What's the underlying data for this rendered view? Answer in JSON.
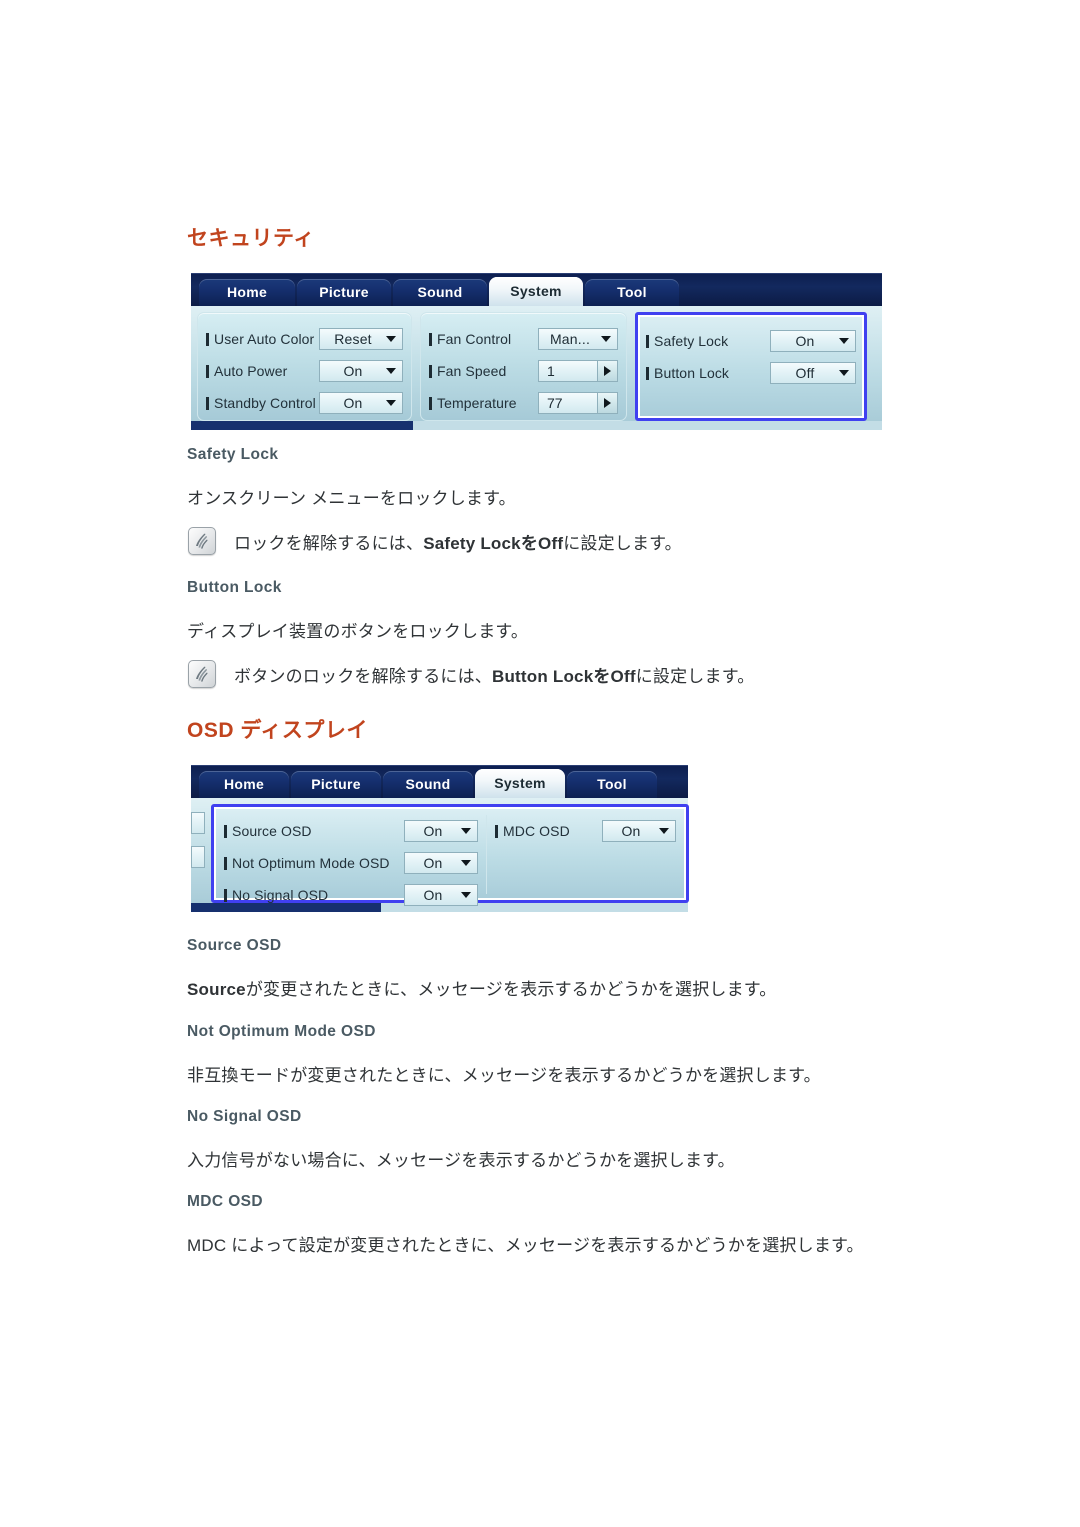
{
  "document": {
    "sections": [
      {
        "id": "security",
        "heading": "セキュリティ",
        "subsections": [
          {
            "title": "Safety Lock",
            "body": "オンスクリーン メニューをロックします。",
            "note": {
              "icon": "note-icon",
              "prefix": "ロックを解除するには、",
              "bold": "Safety LockをOff",
              "suffix": "に設定します。"
            }
          },
          {
            "title": "Button Lock",
            "body": "ディスプレイ装置のボタンをロックします。",
            "note": {
              "icon": "note-icon",
              "prefix": "ボタンのロックを解除するには、",
              "bold": "Button LockをOff",
              "suffix": "に設定します。"
            }
          }
        ]
      },
      {
        "id": "osd-display",
        "heading": "OSD ディスプレイ",
        "subsections": [
          {
            "title": "Source OSD",
            "body_bold": "Source",
            "body": "が変更されたときに、メッセージを表示するかどうかを選択します。"
          },
          {
            "title": "Not Optimum Mode OSD",
            "body": "非互換モードが変更されたときに、メッセージを表示するかどうかを選択します。"
          },
          {
            "title": "No Signal OSD",
            "body": "入力信号がない場合に、メッセージを表示するかどうかを選択します。"
          },
          {
            "title": "MDC OSD",
            "body": "MDC によって設定が変更されたときに、メッセージを表示するかどうかを選択します。"
          }
        ]
      }
    ]
  },
  "osd_security": {
    "tabs": [
      {
        "label": "Home",
        "active": false
      },
      {
        "label": "Picture",
        "active": false
      },
      {
        "label": "Sound",
        "active": false
      },
      {
        "label": "System",
        "active": true
      },
      {
        "label": "Tool",
        "active": false
      }
    ],
    "group_left": [
      {
        "label": "User Auto Color",
        "control": "combo",
        "value": "Reset"
      },
      {
        "label": "Auto Power",
        "control": "combo",
        "value": "On"
      },
      {
        "label": "Standby Control",
        "control": "combo",
        "value": "On"
      }
    ],
    "group_mid": [
      {
        "label": "Fan Control",
        "control": "combo",
        "value": "Man..."
      },
      {
        "label": "Fan Speed",
        "control": "spinner",
        "value": "1"
      },
      {
        "label": "Temperature",
        "control": "spinner",
        "value": "77"
      }
    ],
    "group_right": [
      {
        "label": "Safety Lock",
        "control": "combo",
        "value": "On"
      },
      {
        "label": "Button Lock",
        "control": "combo",
        "value": "Off"
      }
    ]
  },
  "osd_display": {
    "tabs": [
      {
        "label": "Home",
        "active": false
      },
      {
        "label": "Picture",
        "active": false
      },
      {
        "label": "Sound",
        "active": false
      },
      {
        "label": "System",
        "active": true
      },
      {
        "label": "Tool",
        "active": false
      }
    ],
    "group_left": [
      {
        "label": "Source OSD",
        "control": "combo",
        "value": "On"
      },
      {
        "label": "Not Optimum Mode OSD",
        "control": "combo",
        "value": "On"
      },
      {
        "label": "No Signal OSD",
        "control": "combo",
        "value": "On"
      }
    ],
    "group_right": [
      {
        "label": "MDC OSD",
        "control": "combo",
        "value": "On"
      }
    ]
  },
  "colors": {
    "heading": "#c1441e",
    "subheading": "#4a5a63",
    "body": "#2f3336",
    "highlight_border": "#4040f0",
    "tabbar": "#13295e"
  }
}
